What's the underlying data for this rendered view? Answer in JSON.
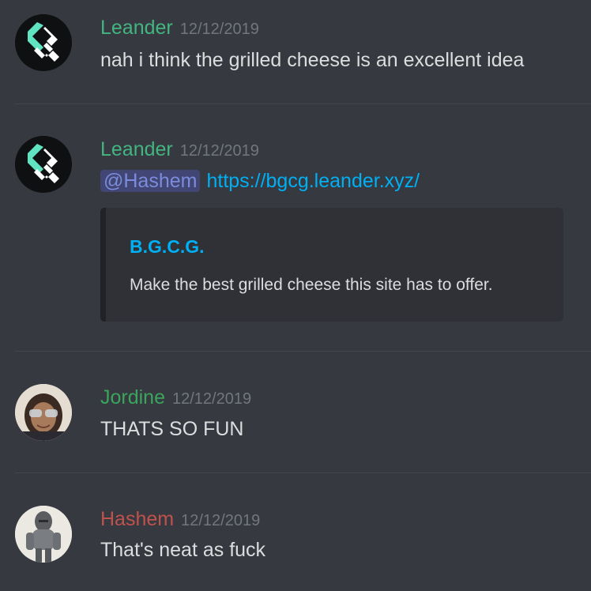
{
  "messages": [
    {
      "author": "Leander",
      "author_color": "#43b581",
      "timestamp": "12/12/2019",
      "text": "nah i think the grilled cheese is an excellent idea",
      "avatar": "leander-logo-avatar"
    },
    {
      "author": "Leander",
      "author_color": "#43b581",
      "timestamp": "12/12/2019",
      "mention": "@Hashem",
      "link": "https://bgcg.leander.xyz/",
      "embed": {
        "title": "B.G.C.G.",
        "description": "Make the best grilled cheese this site has to offer."
      },
      "avatar": "leander-logo-avatar"
    },
    {
      "author": "Jordine",
      "author_color": "#3ba55d",
      "timestamp": "12/12/2019",
      "text": "THATS SO FUN",
      "avatar": "jordine-photo-avatar"
    },
    {
      "author": "Hashem",
      "author_color": "#c0524d",
      "timestamp": "12/12/2019",
      "text": "That's neat as fuck",
      "avatar": "hashem-armor-avatar"
    }
  ]
}
